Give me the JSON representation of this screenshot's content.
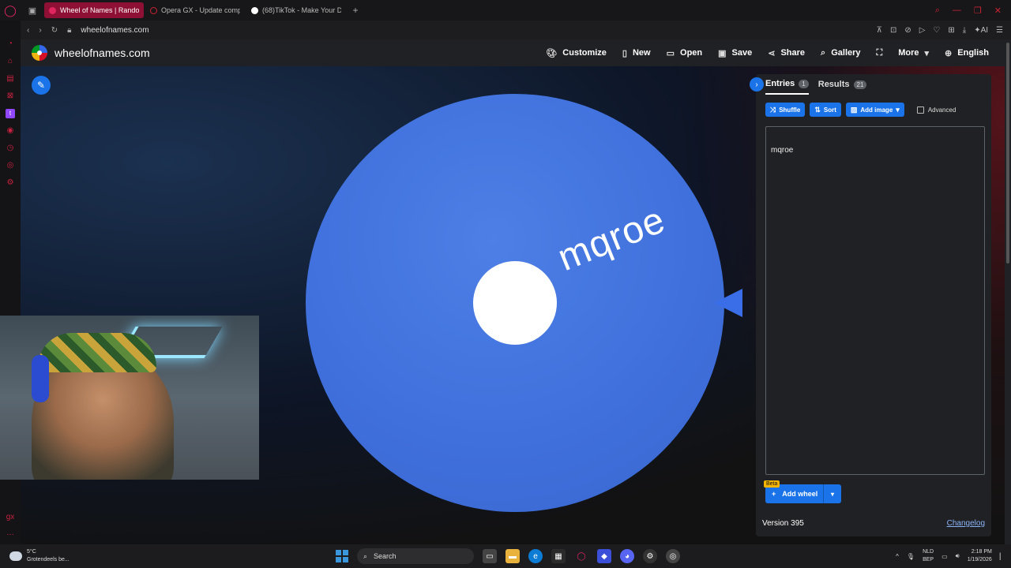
{
  "browser": {
    "tabs": [
      {
        "title": "Wheel of Names | Random",
        "active": true
      },
      {
        "title": "Opera GX - Update comp",
        "active": false
      },
      {
        "title": "(68)TikTok - Make Your D",
        "active": false
      }
    ],
    "new_tab": "+",
    "url": "wheelofnames.com"
  },
  "site": {
    "brand": "wheelofnames.com",
    "menu": [
      "Customize",
      "New",
      "Open",
      "Save",
      "Share",
      "Gallery",
      "More",
      "English"
    ]
  },
  "wheel": {
    "entry_label": "mqroe",
    "color": "#3f6fdb"
  },
  "panel": {
    "tab_entries": "Entries",
    "entries_count": "1",
    "tab_results": "Results",
    "results_count": "21",
    "shuffle": "Shuffle",
    "sort": "Sort",
    "add_image": "Add image",
    "advanced": "Advanced",
    "entries_text": "mqroe",
    "beta": "Beta",
    "add_wheel": "Add wheel",
    "version": "Version 395",
    "changelog": "Changelog"
  },
  "taskbar": {
    "temperature": "5°C",
    "weather_text": "Grotendeels be...",
    "search": "Search",
    "lang1": "NLD",
    "lang2": "BEP",
    "time": "2:18 PM",
    "date": "1/19/2026"
  },
  "colors": {
    "accent": "#1a73e8",
    "opera_red": "#c8213f"
  }
}
